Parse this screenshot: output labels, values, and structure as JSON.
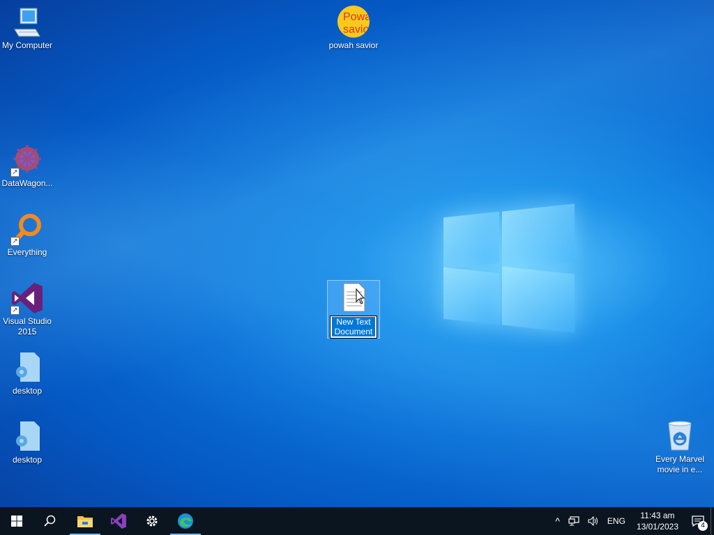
{
  "desktop": {
    "icons": [
      {
        "label": "My Computer"
      },
      {
        "label": "powah savior",
        "img_text": "Powah savior"
      },
      {
        "label": "DataWagon..."
      },
      {
        "label": "Everything"
      },
      {
        "label": "Visual Studio 2015"
      },
      {
        "label": "desktop"
      },
      {
        "label": "desktop"
      },
      {
        "label": "New Text Document"
      },
      {
        "label": "Every Marvel movie in e..."
      }
    ]
  },
  "taskbar": {
    "buttons": [
      "start-icon",
      "search-icon",
      "file-explorer-icon",
      "visual-studio-icon",
      "settings-icon",
      "edge-icon"
    ],
    "tray": {
      "language": "ENG",
      "time": "11:43 am",
      "date": "13/01/2023",
      "notification_count": "4"
    }
  },
  "colors": {
    "accent": "#0078d7",
    "taskbar": "#0b1520"
  }
}
